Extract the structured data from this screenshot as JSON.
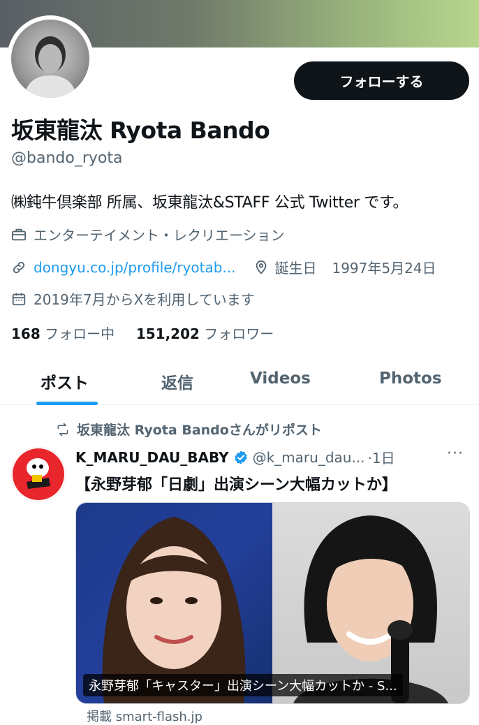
{
  "profile": {
    "name": "坂東龍汰 Ryota Bando",
    "handle": "@bando_ryota",
    "follow_label": "フォローする",
    "bio": "㈱鈍牛倶楽部 所属、坂東龍汰&STAFF 公式 Twitter です。",
    "category": "エンターテイメント・レクリエーション",
    "website": "dongyu.co.jp/profile/ryotab...",
    "birthday_label": "誕生日",
    "birthday": "1997年5月24日",
    "joined": "2019年7月からXを利用しています",
    "following_count": "168",
    "following_label": "フォロー中",
    "followers_count": "151,202",
    "followers_label": "フォロワー"
  },
  "tabs": [
    {
      "label": "ポスト",
      "active": true
    },
    {
      "label": "返信",
      "active": false
    },
    {
      "label": "Videos",
      "active": false
    },
    {
      "label": "Photos",
      "active": false
    }
  ],
  "post": {
    "repost_text": "坂東龍汰 Ryota Bandoさんがリポスト",
    "author_name": "K_MARU_DAU_BABY",
    "author_handle": "@k_maru_dau...",
    "time": "·1日",
    "more": "···",
    "text": "【永野芽郁「日劇」出演シーン大幅カットか】",
    "card_caption": "永野芽郁「キャスター」出演シーン大幅カットか - S...",
    "below_card": "掲載 smart-flash.jp"
  },
  "colors": {
    "accent": "#1d9bf0",
    "text": "#0f1419",
    "muted": "#536471",
    "button": "#0f1419"
  },
  "icons": [
    "briefcase-icon",
    "link-icon",
    "location-pin-icon",
    "calendar-icon",
    "repost-icon",
    "verified-badge-icon",
    "more-icon"
  ]
}
